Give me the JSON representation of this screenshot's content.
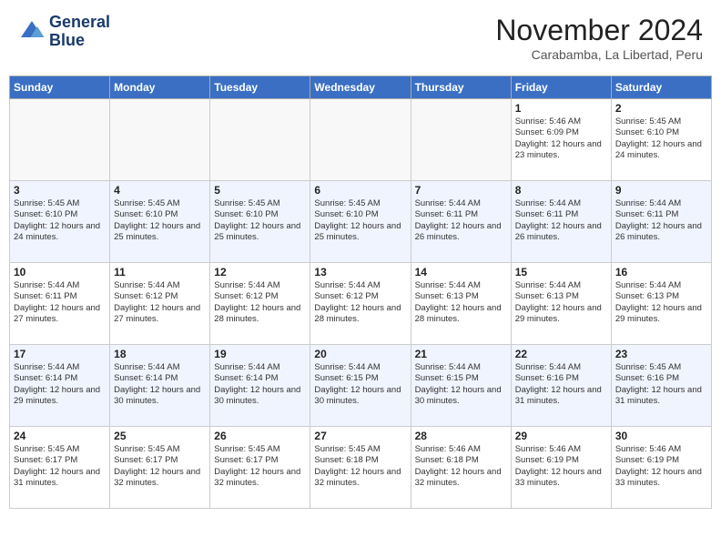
{
  "logo": {
    "line1": "General",
    "line2": "Blue"
  },
  "title": "November 2024",
  "location": "Carabamba, La Libertad, Peru",
  "weekdays": [
    "Sunday",
    "Monday",
    "Tuesday",
    "Wednesday",
    "Thursday",
    "Friday",
    "Saturday"
  ],
  "weeks": [
    [
      {
        "day": "",
        "info": ""
      },
      {
        "day": "",
        "info": ""
      },
      {
        "day": "",
        "info": ""
      },
      {
        "day": "",
        "info": ""
      },
      {
        "day": "",
        "info": ""
      },
      {
        "day": "1",
        "info": "Sunrise: 5:46 AM\nSunset: 6:09 PM\nDaylight: 12 hours and 23 minutes."
      },
      {
        "day": "2",
        "info": "Sunrise: 5:45 AM\nSunset: 6:10 PM\nDaylight: 12 hours and 24 minutes."
      }
    ],
    [
      {
        "day": "3",
        "info": "Sunrise: 5:45 AM\nSunset: 6:10 PM\nDaylight: 12 hours and 24 minutes."
      },
      {
        "day": "4",
        "info": "Sunrise: 5:45 AM\nSunset: 6:10 PM\nDaylight: 12 hours and 25 minutes."
      },
      {
        "day": "5",
        "info": "Sunrise: 5:45 AM\nSunset: 6:10 PM\nDaylight: 12 hours and 25 minutes."
      },
      {
        "day": "6",
        "info": "Sunrise: 5:45 AM\nSunset: 6:10 PM\nDaylight: 12 hours and 25 minutes."
      },
      {
        "day": "7",
        "info": "Sunrise: 5:44 AM\nSunset: 6:11 PM\nDaylight: 12 hours and 26 minutes."
      },
      {
        "day": "8",
        "info": "Sunrise: 5:44 AM\nSunset: 6:11 PM\nDaylight: 12 hours and 26 minutes."
      },
      {
        "day": "9",
        "info": "Sunrise: 5:44 AM\nSunset: 6:11 PM\nDaylight: 12 hours and 26 minutes."
      }
    ],
    [
      {
        "day": "10",
        "info": "Sunrise: 5:44 AM\nSunset: 6:11 PM\nDaylight: 12 hours and 27 minutes."
      },
      {
        "day": "11",
        "info": "Sunrise: 5:44 AM\nSunset: 6:12 PM\nDaylight: 12 hours and 27 minutes."
      },
      {
        "day": "12",
        "info": "Sunrise: 5:44 AM\nSunset: 6:12 PM\nDaylight: 12 hours and 28 minutes."
      },
      {
        "day": "13",
        "info": "Sunrise: 5:44 AM\nSunset: 6:12 PM\nDaylight: 12 hours and 28 minutes."
      },
      {
        "day": "14",
        "info": "Sunrise: 5:44 AM\nSunset: 6:13 PM\nDaylight: 12 hours and 28 minutes."
      },
      {
        "day": "15",
        "info": "Sunrise: 5:44 AM\nSunset: 6:13 PM\nDaylight: 12 hours and 29 minutes."
      },
      {
        "day": "16",
        "info": "Sunrise: 5:44 AM\nSunset: 6:13 PM\nDaylight: 12 hours and 29 minutes."
      }
    ],
    [
      {
        "day": "17",
        "info": "Sunrise: 5:44 AM\nSunset: 6:14 PM\nDaylight: 12 hours and 29 minutes."
      },
      {
        "day": "18",
        "info": "Sunrise: 5:44 AM\nSunset: 6:14 PM\nDaylight: 12 hours and 30 minutes."
      },
      {
        "day": "19",
        "info": "Sunrise: 5:44 AM\nSunset: 6:14 PM\nDaylight: 12 hours and 30 minutes."
      },
      {
        "day": "20",
        "info": "Sunrise: 5:44 AM\nSunset: 6:15 PM\nDaylight: 12 hours and 30 minutes."
      },
      {
        "day": "21",
        "info": "Sunrise: 5:44 AM\nSunset: 6:15 PM\nDaylight: 12 hours and 30 minutes."
      },
      {
        "day": "22",
        "info": "Sunrise: 5:44 AM\nSunset: 6:16 PM\nDaylight: 12 hours and 31 minutes."
      },
      {
        "day": "23",
        "info": "Sunrise: 5:45 AM\nSunset: 6:16 PM\nDaylight: 12 hours and 31 minutes."
      }
    ],
    [
      {
        "day": "24",
        "info": "Sunrise: 5:45 AM\nSunset: 6:17 PM\nDaylight: 12 hours and 31 minutes."
      },
      {
        "day": "25",
        "info": "Sunrise: 5:45 AM\nSunset: 6:17 PM\nDaylight: 12 hours and 32 minutes."
      },
      {
        "day": "26",
        "info": "Sunrise: 5:45 AM\nSunset: 6:17 PM\nDaylight: 12 hours and 32 minutes."
      },
      {
        "day": "27",
        "info": "Sunrise: 5:45 AM\nSunset: 6:18 PM\nDaylight: 12 hours and 32 minutes."
      },
      {
        "day": "28",
        "info": "Sunrise: 5:46 AM\nSunset: 6:18 PM\nDaylight: 12 hours and 32 minutes."
      },
      {
        "day": "29",
        "info": "Sunrise: 5:46 AM\nSunset: 6:19 PM\nDaylight: 12 hours and 33 minutes."
      },
      {
        "day": "30",
        "info": "Sunrise: 5:46 AM\nSunset: 6:19 PM\nDaylight: 12 hours and 33 minutes."
      }
    ]
  ]
}
